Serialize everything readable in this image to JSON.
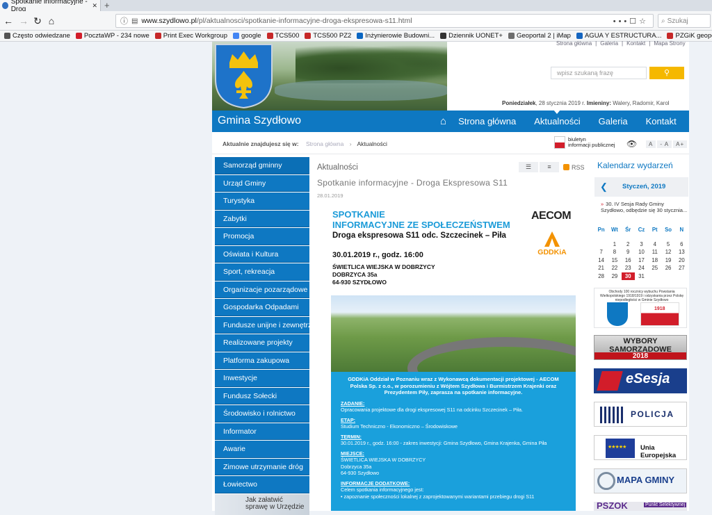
{
  "browser": {
    "tab_title": "Spotkanie informacyjne - Drog",
    "url_host": "www.szydlowo.pl",
    "url_path": "/pl/aktualnosci/spotkanie-informacyjne-droga-ekspresowa-s11.html",
    "search_placeholder": "Szukaj",
    "bookmarks": [
      {
        "label": "Często odwiedzane",
        "color": "#555555"
      },
      {
        "label": "PocztaWP - 234 nowe",
        "color": "#d21d2a"
      },
      {
        "label": "Print Exec Workgroup",
        "color": "#c62828"
      },
      {
        "label": "google",
        "color": "#4285f4"
      },
      {
        "label": "TCS500",
        "color": "#c62828"
      },
      {
        "label": "TCS500 PZ2",
        "color": "#c62828"
      },
      {
        "label": "Inżynierowie Budowni...",
        "color": "#0a66c2"
      },
      {
        "label": "Dziennik UONET+",
        "color": "#333333"
      },
      {
        "label": "Geoportal 2 | iMap",
        "color": "#6d6d6d"
      },
      {
        "label": "AGUA Y ESTRUCTURA...",
        "color": "#1565c0"
      },
      {
        "label": "PZGiK geoportal",
        "color": "#c62828"
      },
      {
        "label": "Pierwsze kroki",
        "color": "#333333"
      }
    ]
  },
  "header": {
    "top_links": [
      "Strona główna",
      "Galeria",
      "Kontakt",
      "Mapa Strony"
    ],
    "search_placeholder": "wpisz szukaną frazę",
    "search_button_icon": "search-icon",
    "date_day": "Poniedziałek",
    "date_text": ", 28 stycznia 2019 r.",
    "names_label": "Imieniny:",
    "names": "Walery, Radomir, Karol"
  },
  "nav": {
    "brand": "Gmina Szydłowo",
    "items": [
      {
        "label": "Strona główna"
      },
      {
        "label": "Aktualności",
        "active": true
      },
      {
        "label": "Galeria"
      },
      {
        "label": "Kontakt"
      }
    ]
  },
  "breadcrumb": {
    "here": "Aktualnie znajdujesz się w:",
    "home": "Strona główna",
    "current": "Aktualności",
    "bip_line1": "biuletyn",
    "bip_line2": "informacji publicznej",
    "font_sizes": [
      "A",
      "- A",
      "A+"
    ]
  },
  "sidebar": {
    "items": [
      "Samorząd gminny",
      "Urząd Gminy",
      "Turystyka",
      "Zabytki",
      "Promocja",
      "Oświata i Kultura",
      "Sport, rekreacja",
      "Organizacje pozarządowe",
      "Gospodarka Odpadami",
      "Fundusze unijne i zewnętrzne",
      "Realizowane projekty",
      "Platforma zakupowa",
      "Inwestycje",
      "Fundusz Sołecki",
      "Środowisko i rolnictwo",
      "Informator",
      "Awarie",
      "Zimowe utrzymanie dróg",
      "Łowiectwo"
    ],
    "promo_line1": "Jak załatwić",
    "promo_line2": "sprawę w Urzędzie"
  },
  "article": {
    "section": "Aktualności",
    "rss": "RSS",
    "title": "Spotkanie informacyjne - Droga Ekspresowa S11",
    "date": "28.01.2019",
    "poster": {
      "h1_line1": "SPOTKANIE",
      "h1_line2": "INFORMACYJNE ZE SPOŁECZEŃSTWEM",
      "h2": "Droga ekspresowa S11 odc. Szczecinek – Piła",
      "time": "30.01.2019 r., godz. 16:00",
      "addr_line1": "ŚWIETLICA WIEJSKA W DOBRZYCY",
      "addr_line2": "DOBRZYCA 35a",
      "addr_line3": "64-930 SZYDŁOWO",
      "aecom": "AECOM",
      "gddkia": "GDDKiA",
      "lead": "GDDKiA Oddział w Poznaniu wraz z Wykonawcą dokumentacji projektowej - AECOM Polska Sp. z o.o., w porozumieniu z Wójtem Szydłowa i Burmistrzem Krajenki oraz Prezydentem Piły, zaprasza na spotkanie informacyjne.",
      "k1": "ZADANIE:",
      "v1": "Opracowania projektowe dla drogi ekspresowej S11 na odcinku Szczecinek – Piła.",
      "k2": "ETAP:",
      "v2": "Studium Techniczno - Ekonomiczno – Środowiskowe",
      "k3": "TERMIN:",
      "v3": "30.01.2019 r., godz. 16:00 - zakres inwestycji: Gmina Szydłowo, Gmina Krajenka, Gmina Piła",
      "k4": "MIEJSCE:",
      "v4a": "ŚWIETLICA WIEJSKA W DOBRZYCY",
      "v4b": "Dobrzyca 35a",
      "v4c": "64-930 Szydłowo",
      "k5": "INFORMACJE DODATKOWE:",
      "v5": "Celem spotkania informacyjnego jest:",
      "v6": "zapoznanie społeczności lokalnej z zaprojektowanymi wariantami przebiegu drogi S11"
    }
  },
  "calendar": {
    "title": "Kalendarz wydarzeń",
    "month": "Styczeń, 2019",
    "event": "30. IV Sesja Rady Gminy Szydłowo, odbędzie się 30 stycznia...",
    "weekdays": [
      "Pn",
      "Wt",
      "Śr",
      "Cz",
      "Pt",
      "So",
      "N"
    ],
    "weeks": [
      [
        "",
        "1",
        "2",
        "3",
        "4",
        "5",
        "6"
      ],
      [
        "7",
        "8",
        "9",
        "10",
        "11",
        "12",
        "13"
      ],
      [
        "14",
        "15",
        "16",
        "17",
        "18",
        "19",
        "20"
      ],
      [
        "21",
        "22",
        "23",
        "24",
        "25",
        "26",
        "27"
      ],
      [
        "28",
        "29",
        "30",
        "31",
        "",
        "",
        ""
      ]
    ],
    "today": "30"
  },
  "ads": {
    "a1_text": "Obchody 100 rocznicy wybuchu Powstania Wielkopolskiego 1918/1919 i odzyskania przez Polskę niepodległości w Gminie Szydłowo",
    "a1_year": "1918",
    "a2_line1": "WYBORY",
    "a2_line2": "SAMORZĄDOWE",
    "a2_year": "2018",
    "a3": "eSesja",
    "a4": "POLICJA",
    "a5": "Unia Europejska",
    "a6": "MAPA GMINY",
    "a7": "PSZOK",
    "a7_sub": "Punkt Selektywnej"
  }
}
